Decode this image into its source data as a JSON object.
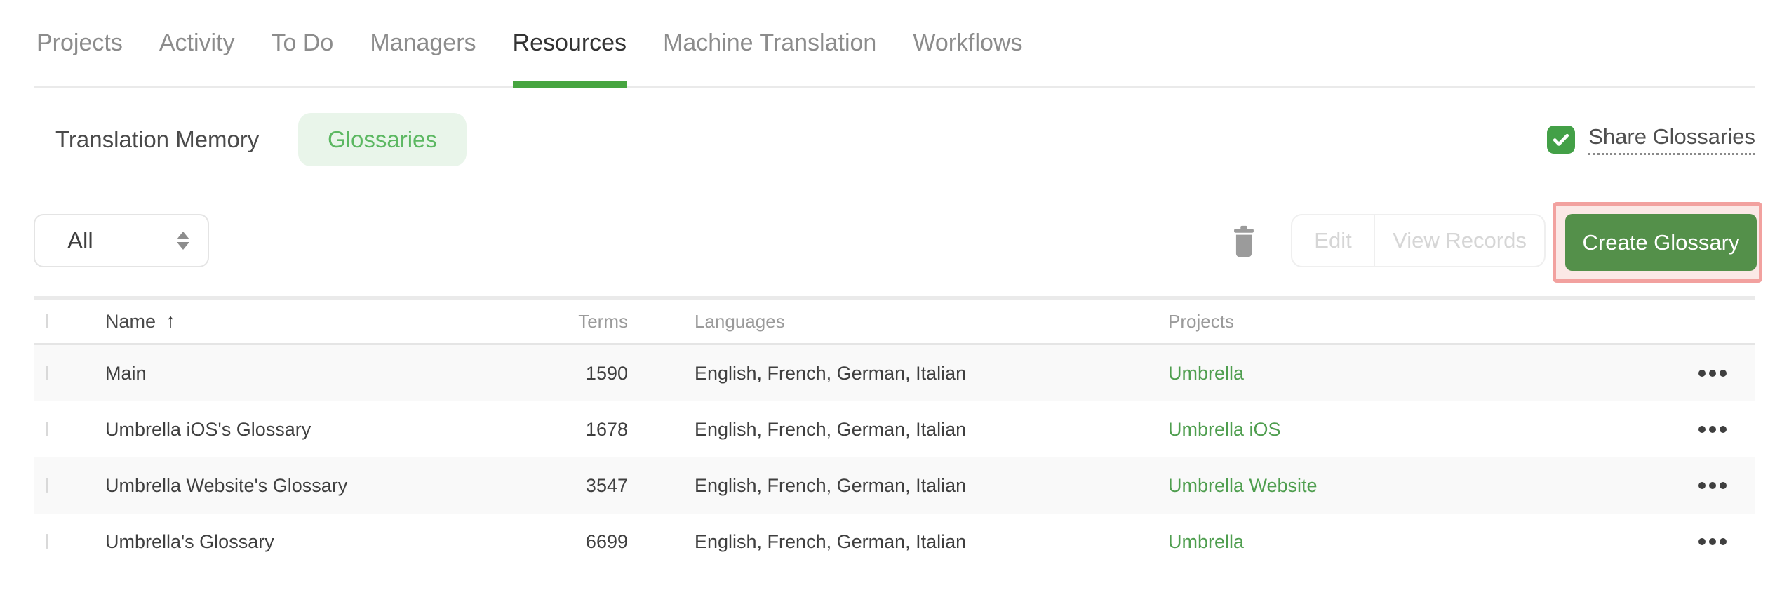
{
  "nav": {
    "tabs": [
      {
        "label": "Projects",
        "active": false
      },
      {
        "label": "Activity",
        "active": false
      },
      {
        "label": "To Do",
        "active": false
      },
      {
        "label": "Managers",
        "active": false
      },
      {
        "label": "Resources",
        "active": true
      },
      {
        "label": "Machine Translation",
        "active": false
      },
      {
        "label": "Workflows",
        "active": false
      }
    ]
  },
  "subtabs": {
    "translation_memory_label": "Translation Memory",
    "glossaries_label": "Glossaries"
  },
  "share_glossaries": {
    "label": "Share Glossaries",
    "checked": true
  },
  "toolbar": {
    "filter_selected": "All",
    "edit_label": "Edit",
    "view_records_label": "View Records",
    "create_glossary_label": "Create Glossary"
  },
  "icons": {
    "trash": "trash-can",
    "select_sorter": "up-down-triangles",
    "share_check": "checkmark",
    "row_actions": "horizontal-ellipsis"
  },
  "table": {
    "headers": {
      "name": "Name",
      "terms": "Terms",
      "languages": "Languages",
      "projects": "Projects"
    },
    "sort": {
      "column": "Name",
      "direction": "ascending",
      "arrow": "↑"
    },
    "rows": [
      {
        "name": "Main",
        "terms": "1590",
        "languages": "English, French, German, Italian",
        "project": "Umbrella"
      },
      {
        "name": "Umbrella iOS's Glossary",
        "terms": "1678",
        "languages": "English, French, German, Italian",
        "project": "Umbrella iOS"
      },
      {
        "name": "Umbrella Website's Glossary",
        "terms": "3547",
        "languages": "English, French, German, Italian",
        "project": "Umbrella Website"
      },
      {
        "name": "Umbrella's Glossary",
        "terms": "6699",
        "languages": "English, French, German, Italian",
        "project": "Umbrella"
      }
    ]
  },
  "colors": {
    "brand_green_underline": "#46a53f",
    "create_button_green": "#54904a",
    "project_link_green": "#4f9e4f",
    "glossaries_pill_bg": "#e9f5ea",
    "glossaries_pill_text": "#5cb862",
    "share_checkbox_green": "#43a047",
    "annotation_border": "#f2a19f",
    "annotation_bg": "#fbe8e6",
    "disabled_button_text": "#d6d6d6",
    "row_alt_bg": "#f9f9f9"
  }
}
